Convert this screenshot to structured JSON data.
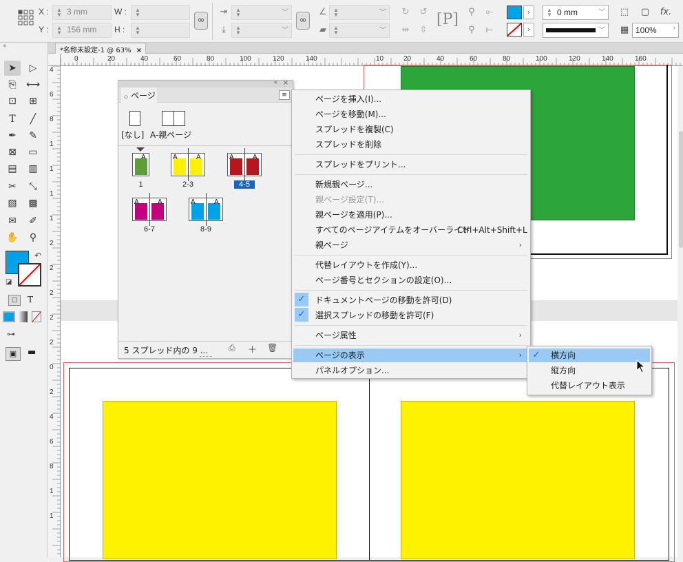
{
  "control": {
    "x_label": "X :",
    "y_label": "Y :",
    "w_label": "W :",
    "h_label": "H :",
    "x_value": "3 mm",
    "y_value": "156 mm",
    "stroke_weight": "0 mm",
    "opacity": "100%",
    "fx_label": "fx.",
    "p_glyph": "P"
  },
  "doc_tab": {
    "title": "*名称未設定-1 @ 63%",
    "close": "×"
  },
  "hruler_ticks": [
    "0",
    "20",
    "40",
    "60",
    "80",
    "100",
    "120",
    "140",
    "10",
    "20",
    "40",
    "60",
    "80",
    "100",
    "120",
    "140",
    "160"
  ],
  "vruler_ticks": [
    "4",
    "6",
    "8",
    "1",
    "1",
    "1",
    "1",
    "2",
    "2",
    "2",
    "2",
    "2",
    "0",
    "2",
    "4",
    "6",
    "8",
    "1",
    "1"
  ],
  "pages_panel": {
    "title": "ページ",
    "master_none": "[なし]",
    "master_a": "A-親ページ",
    "marker": "A",
    "spreads": [
      {
        "label": "1",
        "color": "#5e9e3a"
      },
      {
        "label": "2-3",
        "color": "#fff200"
      },
      {
        "label": "4-5",
        "color": "#b5171f"
      },
      {
        "label": "6-7",
        "color": "#c4007f"
      },
      {
        "label": "8-9",
        "color": "#00a2e8"
      }
    ],
    "status": "5 スプレッド内の 9 ...",
    "new_page_icon": "＋",
    "trash_icon": "🗑"
  },
  "menu": {
    "items": [
      "ページを挿入(I)...",
      "ページを移動(M)...",
      "スプレッドを複製(C)",
      "スプレッドを削除",
      "スプレッドをプリント...",
      "新規親ページ...",
      "親ページ設定(T)...",
      "親ページを適用(P)...",
      "すべてのページアイテムをオーバーライド",
      "親ページ",
      "代替レイアウトを作成(Y)...",
      "ページ番号とセクションの設定(O)...",
      "ドキュメントページの移動を許可(D)",
      "選択スプレッドの移動を許可(F)",
      "ページ属性",
      "ページの表示",
      "パネルオプション..."
    ],
    "override_shortcut": "Ctrl+Alt+Shift+L",
    "check_glyph": "✓",
    "arrow_glyph": "›"
  },
  "submenu": {
    "items": [
      "横方向",
      "縦方向",
      "代替レイアウト表示"
    ]
  },
  "colors": {
    "fill": "#00a2e8",
    "green": "#2ca53a",
    "yellow": "#fff200",
    "highlight": "#99c9f5"
  }
}
